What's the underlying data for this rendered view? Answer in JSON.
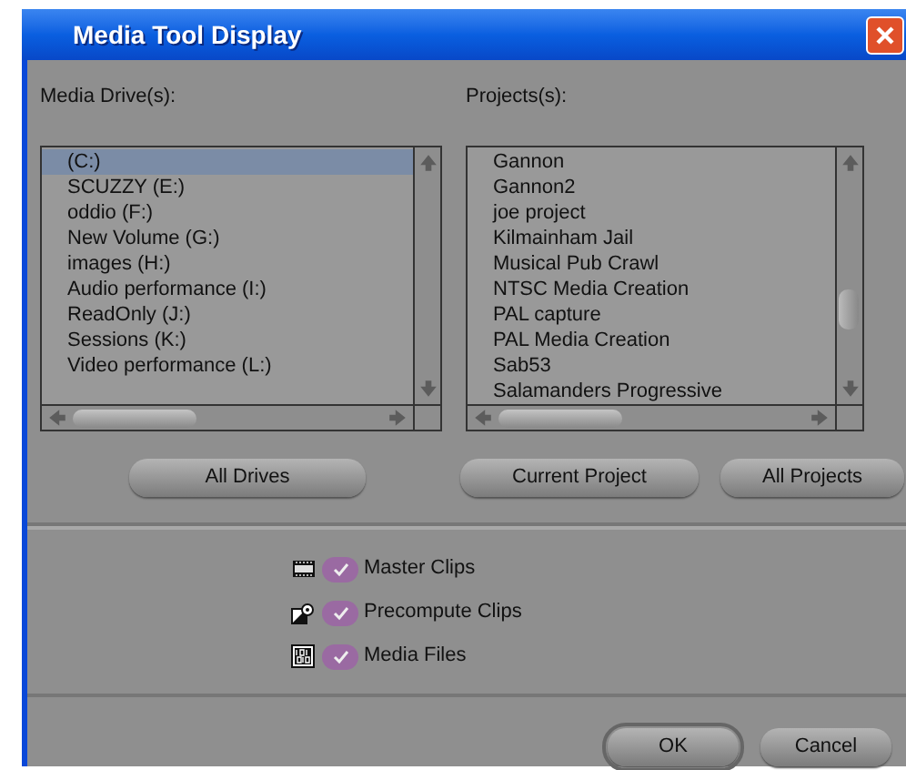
{
  "window": {
    "title": "Media Tool Display"
  },
  "drives": {
    "label": "Media Drive(s):",
    "items": [
      {
        "label": "(C:)",
        "selected": true
      },
      {
        "label": "SCUZZY (E:)",
        "selected": false
      },
      {
        "label": "oddio (F:)",
        "selected": false
      },
      {
        "label": "New Volume (G:)",
        "selected": false
      },
      {
        "label": "images (H:)",
        "selected": false
      },
      {
        "label": "Audio performance (I:)",
        "selected": false
      },
      {
        "label": "ReadOnly (J:)",
        "selected": false
      },
      {
        "label": "Sessions (K:)",
        "selected": false
      },
      {
        "label": "Video performance (L:)",
        "selected": false
      }
    ],
    "button": "All Drives"
  },
  "projects": {
    "label": "Projects(s):",
    "items": [
      {
        "label": "Gannon",
        "selected": false
      },
      {
        "label": "Gannon2",
        "selected": false
      },
      {
        "label": "joe project",
        "selected": false
      },
      {
        "label": "Kilmainham Jail",
        "selected": false
      },
      {
        "label": "Musical Pub Crawl",
        "selected": false
      },
      {
        "label": "NTSC Media Creation",
        "selected": false
      },
      {
        "label": "PAL capture",
        "selected": false
      },
      {
        "label": "PAL Media Creation",
        "selected": false
      },
      {
        "label": "Sab53",
        "selected": false
      },
      {
        "label": "Salamanders Progressive",
        "selected": false
      }
    ],
    "buttons": [
      "Current Project",
      "All Projects"
    ]
  },
  "options": [
    {
      "kind": "clips",
      "label": "Master Clips",
      "checked": true
    },
    {
      "kind": "precompute",
      "label": "Precompute Clips",
      "checked": true
    },
    {
      "kind": "files",
      "label": "Media Files",
      "checked": true
    }
  ],
  "footer_buttons": [
    {
      "label": "OK",
      "default": true
    },
    {
      "label": "Cancel",
      "default": false
    }
  ]
}
